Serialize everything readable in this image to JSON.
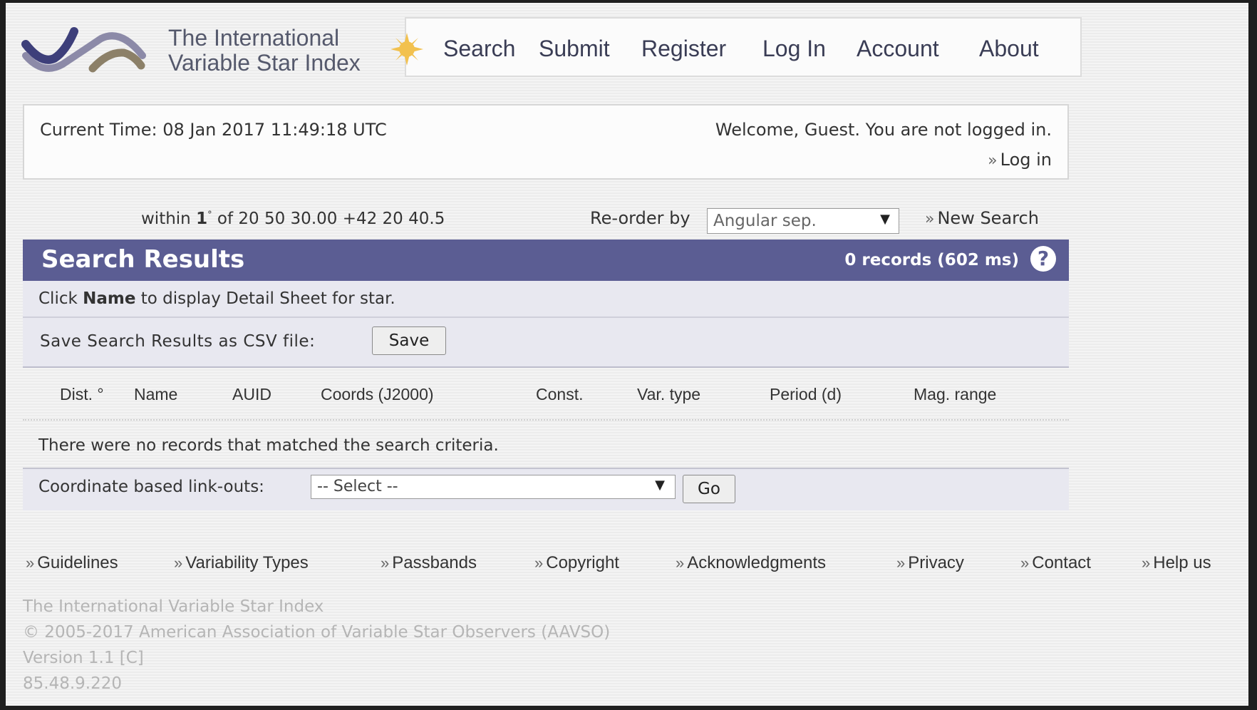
{
  "header": {
    "logo_line1": "The International",
    "logo_line2": "Variable Star Index"
  },
  "nav": [
    "Search",
    "Submit",
    "Register",
    "Log In",
    "Account",
    "About"
  ],
  "status": {
    "current_time": "Current Time: 08 Jan 2017 11:49:18 UTC",
    "welcome": "Welcome, Guest. You are not logged in.",
    "login_link": "Log in"
  },
  "query": {
    "within_prefix": "within",
    "radius": "1",
    "deg": "°",
    "of": "of",
    "coords": "20 50 30.00 +42 20 40.5",
    "reorder_label": "Re-order by",
    "reorder_value": "Angular sep.",
    "new_search": "New Search"
  },
  "results": {
    "title": "Search Results",
    "records": "0 records (602 ms)",
    "help": "?",
    "hint_prefix": "Click",
    "hint_bold": "Name",
    "hint_suffix": "to display Detail Sheet for star.",
    "save_label": "Save Search Results as CSV file:",
    "save_button": "Save",
    "columns": [
      "Dist. °",
      "Name",
      "AUID",
      "Coords (J2000)",
      "Const.",
      "Var. type",
      "Period (d)",
      "Mag. range"
    ],
    "no_records": "There were no records that matched the search criteria.",
    "linkout_label": "Coordinate based link-outs:",
    "linkout_value": "-- Select --",
    "go_button": "Go"
  },
  "footer": {
    "links": [
      "Guidelines",
      "Variability Types",
      "Passbands",
      "Copyright",
      "Acknowledgments",
      "Privacy",
      "Contact",
      "Help us"
    ],
    "line1": "The International Variable Star Index",
    "line2": "© 2005-2017 American Association of Variable Star Observers (AAVSO)",
    "line3": "Version 1.1 [C]",
    "line4": "85.48.9.220"
  },
  "colors": {
    "header_bar": "#5b5d93",
    "row_bg": "#e8e8f0",
    "logo_dark": "#3d3f7a",
    "logo_tan": "#8c8068",
    "sun": "#f2c14e"
  }
}
